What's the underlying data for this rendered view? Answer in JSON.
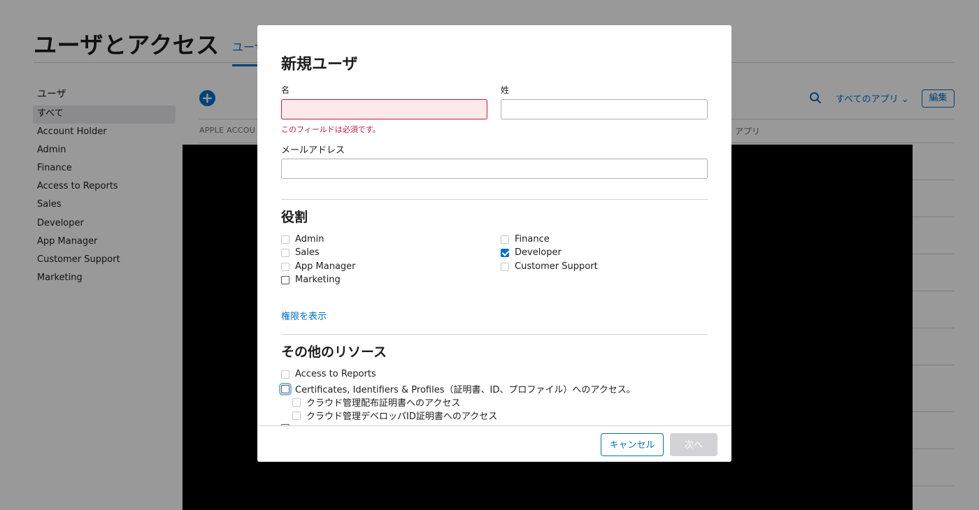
{
  "page": {
    "title": "ユーザとアクセス",
    "tab_label": "ユーザ",
    "sidebar": {
      "heading": "ユーザ",
      "items": [
        {
          "label": "すべて",
          "active": true
        },
        {
          "label": "Account Holder"
        },
        {
          "label": "Admin"
        },
        {
          "label": "Finance"
        },
        {
          "label": "Access to Reports"
        },
        {
          "label": "Sales"
        },
        {
          "label": "Developer"
        },
        {
          "label": "App Manager"
        },
        {
          "label": "Customer Support"
        },
        {
          "label": "Marketing"
        }
      ]
    },
    "toolbar": {
      "add_icon": "plus-circle-icon",
      "search_icon": "search-icon",
      "apps_filter": "すべてのアプリ ⌄",
      "edit_label": "編集"
    },
    "table": {
      "col_apple_account": "APPLE ACCOU",
      "col_apps": "アプリ"
    }
  },
  "modal": {
    "title": "新規ユーザ",
    "first_name": {
      "label": "名",
      "value": "",
      "error": "このフィールドは必須です。"
    },
    "last_name": {
      "label": "姓",
      "value": ""
    },
    "email": {
      "label": "メールアドレス",
      "value": ""
    },
    "roles": {
      "title": "役割",
      "left": [
        {
          "label": "Admin",
          "checked": false,
          "enabled": false
        },
        {
          "label": "Sales",
          "checked": false,
          "enabled": false
        },
        {
          "label": "App Manager",
          "checked": false,
          "enabled": false
        },
        {
          "label": "Marketing",
          "checked": false,
          "enabled": true
        }
      ],
      "right": [
        {
          "label": "Finance",
          "checked": false,
          "enabled": false
        },
        {
          "label": "Developer",
          "checked": true,
          "enabled": true
        },
        {
          "label": "Customer Support",
          "checked": false,
          "enabled": false
        }
      ],
      "permissions_link": "権限を表示"
    },
    "resources": {
      "title": "その他のリソース",
      "items": [
        {
          "label": "Access to Reports",
          "checked": false,
          "enabled": false
        },
        {
          "label": "Certificates, Identifiers & Profiles（証明書、ID、プロファイル）へのアクセス。",
          "checked": false,
          "enabled": true,
          "focused": true
        },
        {
          "label": "クラウド管理配布証明書へのアクセス",
          "checked": false,
          "enabled": false,
          "indent": true
        },
        {
          "label": "クラウド管理デベロッパID証明書へのアクセス",
          "checked": false,
          "enabled": false,
          "indent": true
        }
      ]
    },
    "footer": {
      "cancel_label": "キャンセル",
      "next_label": "次へ"
    }
  }
}
